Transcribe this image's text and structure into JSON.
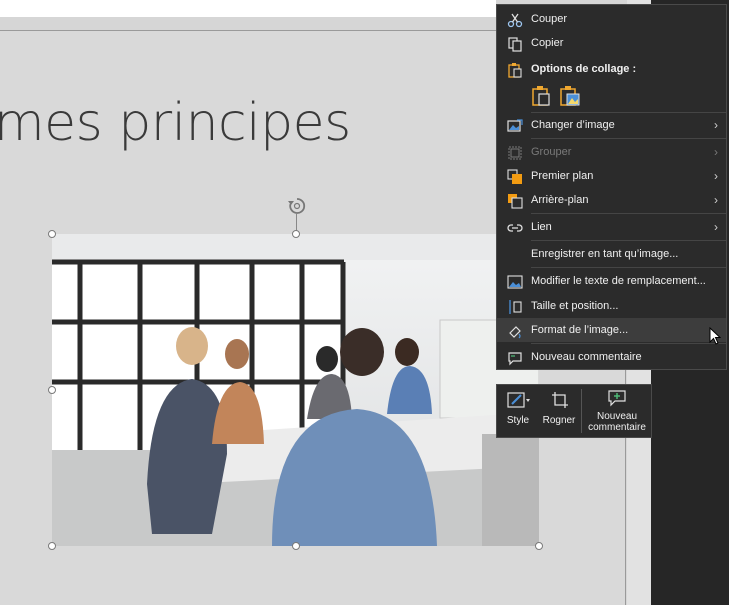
{
  "slide": {
    "title": "mes principes"
  },
  "context_menu": {
    "cut": "Couper",
    "copy": "Copier",
    "paste_options": "Options de collage :",
    "change_image": "Changer d’image",
    "group": "Grouper",
    "bring_forward": "Premier plan",
    "send_backward": "Arrière-plan",
    "link": "Lien",
    "save_as_image": "Enregistrer en tant qu’image...",
    "edit_alt_text": "Modifier le texte de remplacement...",
    "size_position": "Taille et position...",
    "format_image": "Format de l’image...",
    "new_comment": "Nouveau commentaire"
  },
  "mini_toolbar": {
    "style": "Style",
    "crop": "Rogner",
    "new_comment_line1": "Nouveau",
    "new_comment_line2": "commentaire"
  },
  "colors": {
    "menu_bg": "#2b2b2b",
    "paste_icon": "#f0a830",
    "order_icon": "#f39c12"
  }
}
